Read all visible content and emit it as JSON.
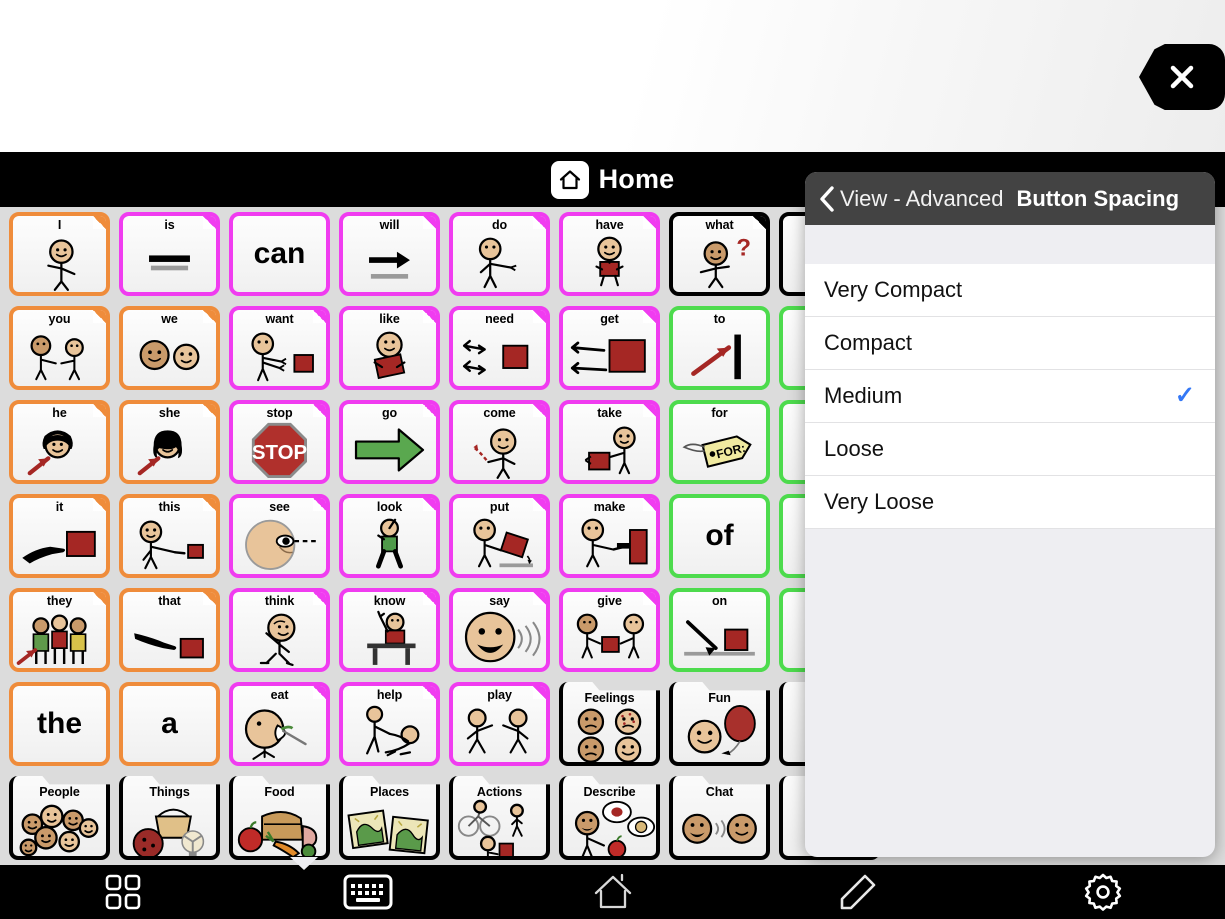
{
  "message_bar": {
    "text": "",
    "close_label": "close-icon"
  },
  "header": {
    "title": "Home",
    "home_icon": "home-icon"
  },
  "grid": {
    "rows": 7,
    "cols": 8,
    "colors": {
      "pronoun": "#ef8c3b",
      "verb": "#f03cf0",
      "question": "#000000",
      "preposition": "#4ddb4d",
      "folder": "#000000",
      "describe": "#3b7fd4"
    },
    "buttons": [
      {
        "label": "I",
        "style": "pronoun",
        "art": "person-pointing-self",
        "kind": "word"
      },
      {
        "label": "is",
        "style": "verb",
        "art": "equals-bars",
        "kind": "word"
      },
      {
        "label": "can",
        "style": "verb",
        "art": "text-only",
        "kind": "word",
        "big": "can"
      },
      {
        "label": "will",
        "style": "verb",
        "art": "arrow-right-black",
        "kind": "word"
      },
      {
        "label": "do",
        "style": "verb",
        "art": "person-action",
        "kind": "word"
      },
      {
        "label": "have",
        "style": "verb",
        "art": "person-holding-box",
        "kind": "word"
      },
      {
        "label": "what",
        "style": "question",
        "art": "person-question",
        "kind": "word"
      },
      {
        "label": "",
        "style": "question",
        "art": "hidden",
        "kind": "word"
      },
      {
        "label": "you",
        "style": "pronoun",
        "art": "two-people-pointing",
        "kind": "word"
      },
      {
        "label": "we",
        "style": "pronoun",
        "art": "two-faces",
        "kind": "word"
      },
      {
        "label": "want",
        "style": "verb",
        "art": "person-reach-box",
        "kind": "word"
      },
      {
        "label": "like",
        "style": "verb",
        "art": "person-hugging-box",
        "kind": "word"
      },
      {
        "label": "need",
        "style": "verb",
        "art": "hands-box",
        "kind": "word"
      },
      {
        "label": "get",
        "style": "verb",
        "art": "hands-big-box",
        "kind": "word"
      },
      {
        "label": "to",
        "style": "preposition",
        "art": "arrow-to-bar",
        "kind": "word"
      },
      {
        "label": "",
        "style": "preposition",
        "art": "hidden",
        "kind": "word"
      },
      {
        "label": "he",
        "style": "pronoun",
        "art": "boy-face-arrow",
        "kind": "word"
      },
      {
        "label": "she",
        "style": "pronoun",
        "art": "girl-face-arrow",
        "kind": "word"
      },
      {
        "label": "stop",
        "style": "verb",
        "art": "stop-sign",
        "kind": "word"
      },
      {
        "label": "go",
        "style": "verb",
        "art": "arrow-right-green",
        "kind": "word"
      },
      {
        "label": "come",
        "style": "verb",
        "art": "person-come",
        "kind": "word"
      },
      {
        "label": "take",
        "style": "verb",
        "art": "person-take-box",
        "kind": "word"
      },
      {
        "label": "for",
        "style": "preposition",
        "art": "for-tag",
        "kind": "word"
      },
      {
        "label": "",
        "style": "preposition",
        "art": "hidden",
        "kind": "word"
      },
      {
        "label": "it",
        "style": "pronoun",
        "art": "hand-point-box",
        "kind": "word"
      },
      {
        "label": "this",
        "style": "pronoun",
        "art": "person-point-box",
        "kind": "word"
      },
      {
        "label": "see",
        "style": "verb",
        "art": "eye-line",
        "kind": "word"
      },
      {
        "label": "look",
        "style": "verb",
        "art": "person-walking-look",
        "kind": "word"
      },
      {
        "label": "put",
        "style": "verb",
        "art": "person-put-box",
        "kind": "word"
      },
      {
        "label": "make",
        "style": "verb",
        "art": "person-hammer",
        "kind": "word"
      },
      {
        "label": "of",
        "style": "preposition",
        "art": "text-only",
        "kind": "word",
        "big": "of"
      },
      {
        "label": "",
        "style": "preposition",
        "art": "hidden",
        "kind": "word"
      },
      {
        "label": "they",
        "style": "pronoun",
        "art": "three-people",
        "kind": "word"
      },
      {
        "label": "that",
        "style": "pronoun",
        "art": "hand-point-box2",
        "kind": "word"
      },
      {
        "label": "think",
        "style": "verb",
        "art": "person-thinking",
        "kind": "word"
      },
      {
        "label": "know",
        "style": "verb",
        "art": "person-desk-hand",
        "kind": "word"
      },
      {
        "label": "say",
        "style": "verb",
        "art": "face-talking",
        "kind": "word"
      },
      {
        "label": "give",
        "style": "verb",
        "art": "two-people-box",
        "kind": "word"
      },
      {
        "label": "on",
        "style": "preposition",
        "art": "arrow-on-box",
        "kind": "word"
      },
      {
        "label": "",
        "style": "preposition",
        "art": "hidden",
        "kind": "word"
      },
      {
        "label": "the",
        "style": "pronoun",
        "art": "text-only",
        "kind": "word",
        "big": "the"
      },
      {
        "label": "a",
        "style": "pronoun",
        "art": "text-only",
        "kind": "word",
        "big": "a"
      },
      {
        "label": "eat",
        "style": "verb",
        "art": "person-eating",
        "kind": "word"
      },
      {
        "label": "help",
        "style": "verb",
        "art": "person-helping",
        "kind": "word"
      },
      {
        "label": "play",
        "style": "verb",
        "art": "two-people-playing",
        "kind": "word"
      },
      {
        "label": "Feelings",
        "style": "folder",
        "art": "four-faces",
        "kind": "folder"
      },
      {
        "label": "Fun",
        "style": "folder",
        "art": "face-balloon",
        "kind": "folder"
      },
      {
        "label": "",
        "style": "folder",
        "art": "hidden",
        "kind": "folder"
      },
      {
        "label": "People",
        "style": "folder",
        "art": "many-faces",
        "kind": "folder"
      },
      {
        "label": "Things",
        "style": "folder",
        "art": "basket-ball-fan",
        "kind": "folder"
      },
      {
        "label": "Food",
        "style": "folder",
        "art": "food-group",
        "kind": "folder"
      },
      {
        "label": "Places",
        "style": "folder",
        "art": "two-maps",
        "kind": "folder"
      },
      {
        "label": "Actions",
        "style": "folder",
        "art": "bike-walk",
        "kind": "folder"
      },
      {
        "label": "Describe",
        "style": "folder",
        "art": "person-apple-speech",
        "kind": "folder"
      },
      {
        "label": "Chat",
        "style": "folder",
        "art": "two-faces-talk",
        "kind": "folder"
      },
      {
        "label": "",
        "style": "folder",
        "art": "hidden",
        "kind": "folder"
      }
    ]
  },
  "popover": {
    "back_label": "View - Advanced",
    "title": "Button Spacing",
    "back_icon": "chevron-left-icon",
    "check_color": "#3478f6",
    "check_glyph": "✓",
    "options": [
      {
        "label": "Very Compact",
        "selected": false
      },
      {
        "label": "Compact",
        "selected": false
      },
      {
        "label": "Medium",
        "selected": true
      },
      {
        "label": "Loose",
        "selected": false
      },
      {
        "label": "Very Loose",
        "selected": false
      }
    ]
  },
  "toolbar": {
    "items": [
      {
        "icon": "grid-icon",
        "name": "grid-view-button"
      },
      {
        "icon": "keyboard-icon",
        "name": "keyboard-button"
      },
      {
        "icon": "home-icon",
        "name": "home-button"
      },
      {
        "icon": "pencil-icon",
        "name": "edit-button"
      },
      {
        "icon": "gear-icon",
        "name": "settings-button"
      }
    ]
  }
}
